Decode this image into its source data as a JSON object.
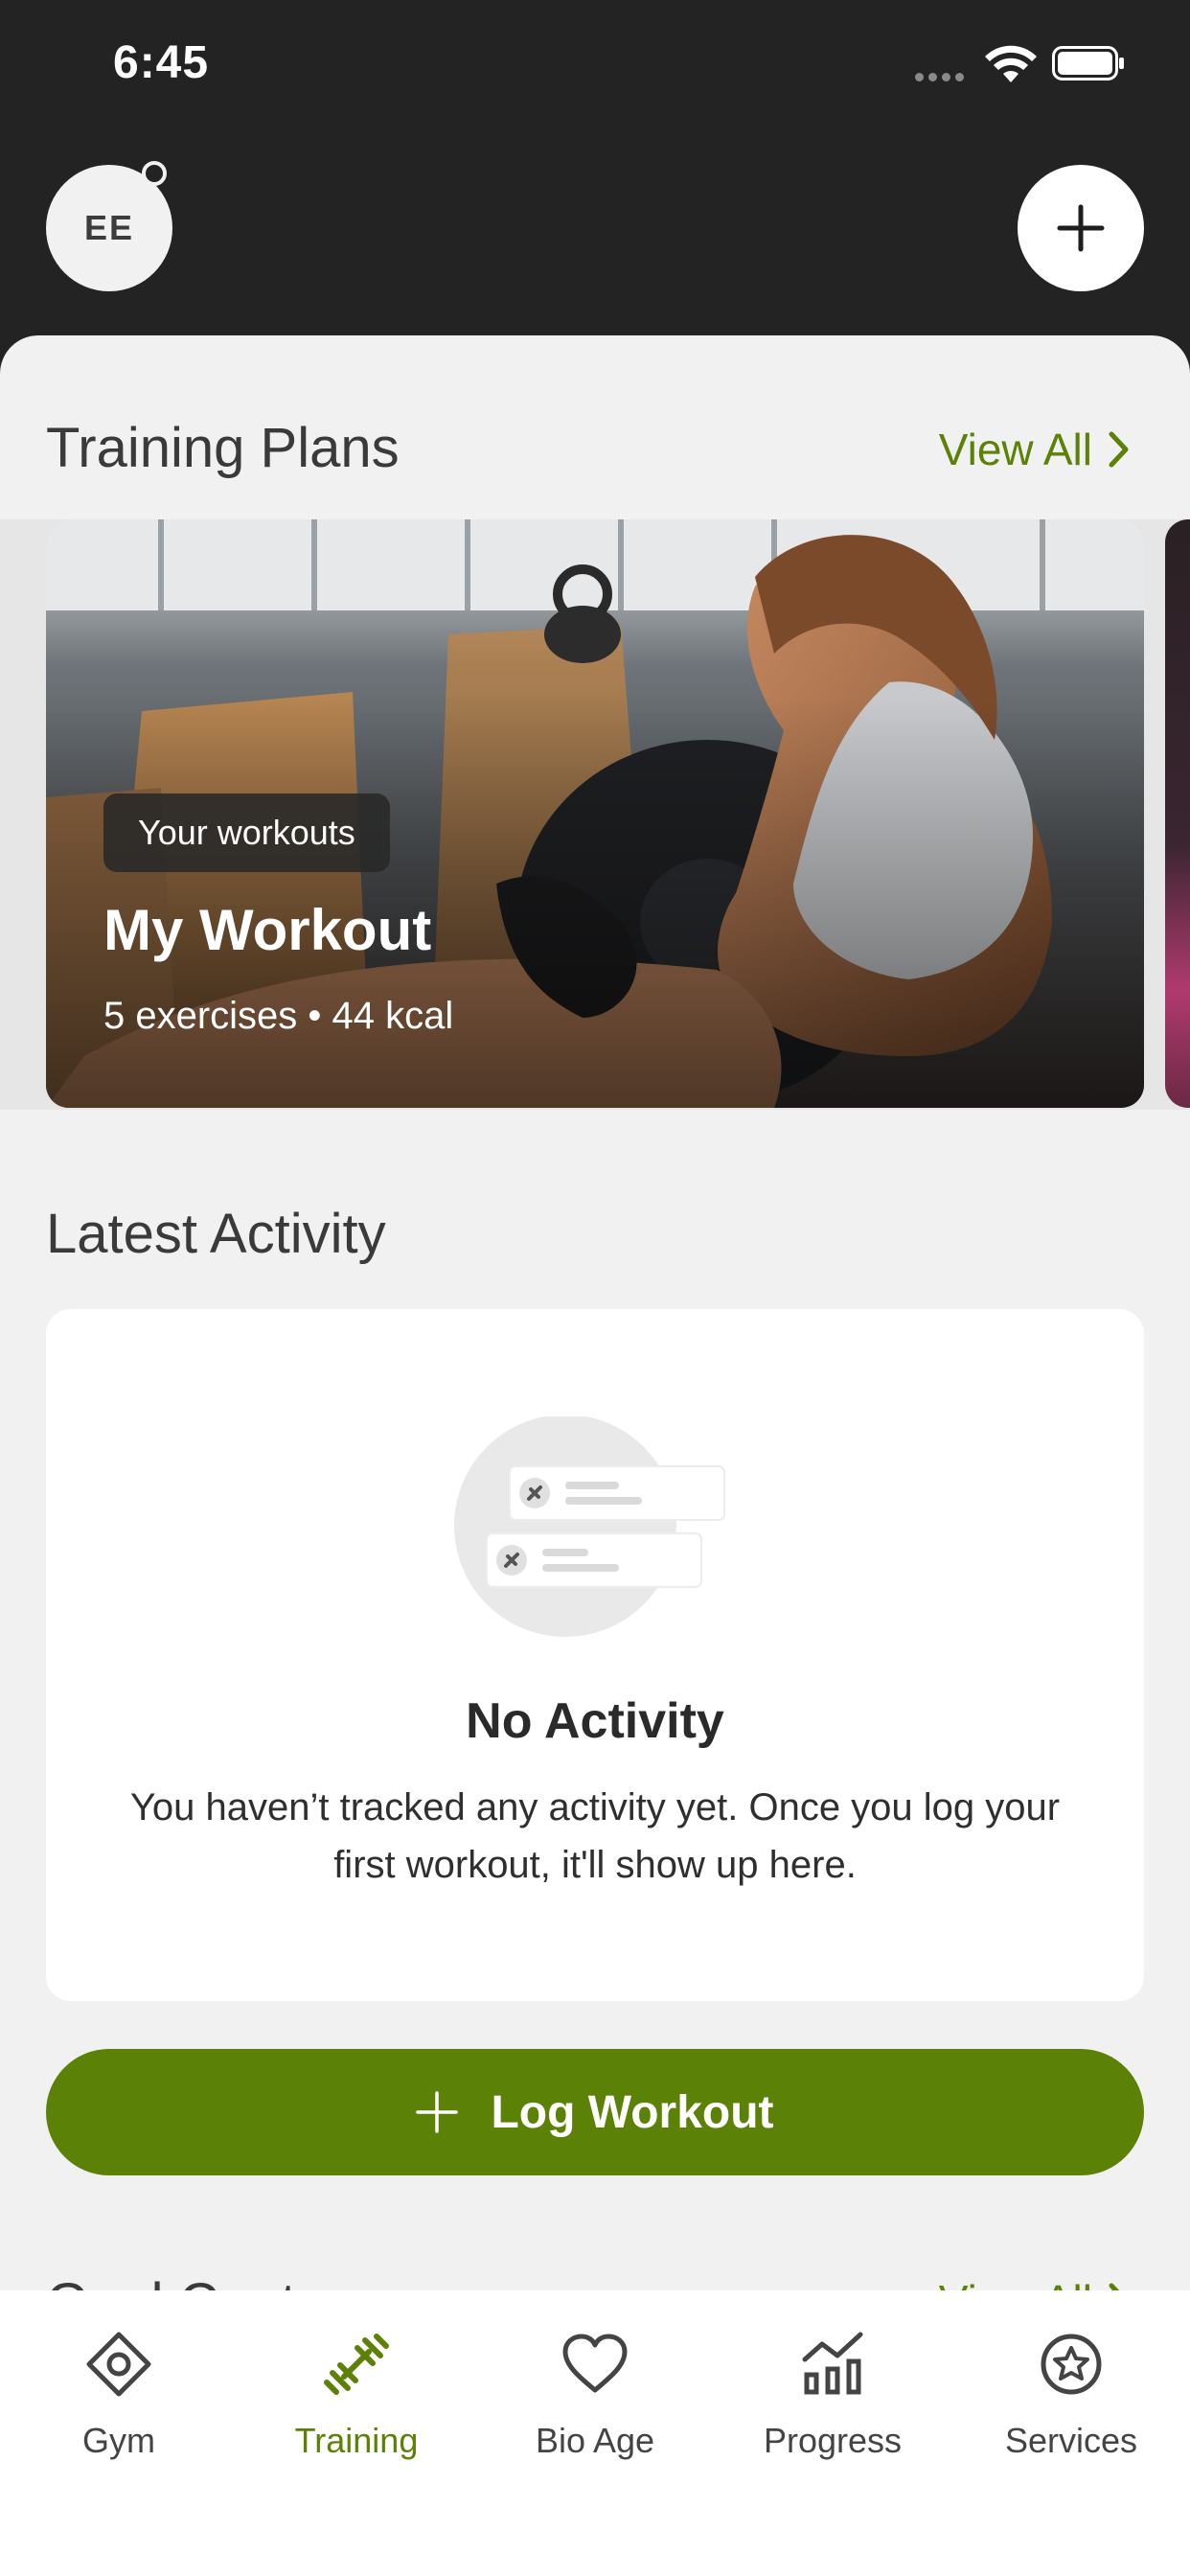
{
  "status_bar": {
    "time": "6:45"
  },
  "header": {
    "avatar_initials": "EE"
  },
  "training_plans": {
    "title": "Training Plans",
    "view_all": "View All",
    "card": {
      "tag": "Your workouts",
      "title": "My Workout",
      "meta": "5 exercises • 44 kcal"
    }
  },
  "latest_activity": {
    "title": "Latest Activity",
    "empty_title": "No Activity",
    "empty_text": "You haven’t tracked any activity yet. Once you log your first workout, it'll show up here."
  },
  "log_button": {
    "label": "Log Workout"
  },
  "goal_center": {
    "title": "Goal Center",
    "view_all": "View All"
  },
  "tabs": [
    {
      "label": "Gym",
      "icon": "gym-icon",
      "active": false
    },
    {
      "label": "Training",
      "icon": "dumbbell-icon",
      "active": true
    },
    {
      "label": "Bio Age",
      "icon": "heart-icon",
      "active": false
    },
    {
      "label": "Progress",
      "icon": "progress-chart-icon",
      "active": false
    },
    {
      "label": "Services",
      "icon": "star-badge-icon",
      "active": false
    }
  ],
  "colors": {
    "accent": "#5b8106",
    "header_bg": "#232323",
    "sheet_bg": "#f1f1f1"
  }
}
